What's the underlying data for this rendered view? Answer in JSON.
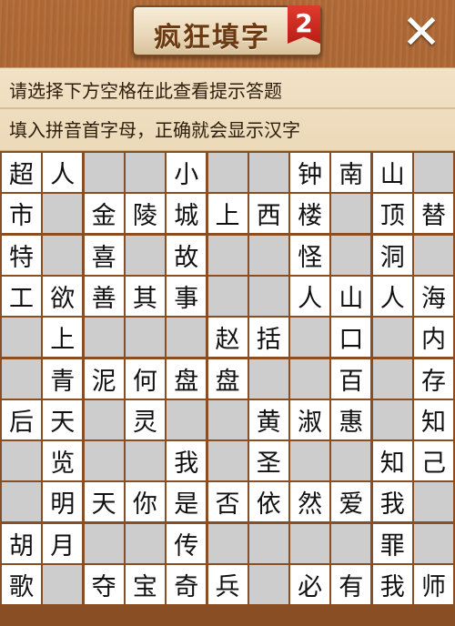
{
  "app": {
    "title": "疯狂填字",
    "level": "2",
    "close_icon": "close-x-icon"
  },
  "hints": {
    "line1": "请选择下方空格在此查看提示答题",
    "line2": "填入拼音首字母，正确就会显示汉字"
  },
  "colors": {
    "wood": "#a5612f",
    "panel": "#f0dfc1",
    "cell_filled": "#ffffff",
    "cell_empty": "#cdcdcd",
    "badge_red": "#d42b22"
  },
  "grid": {
    "rows": [
      [
        "超",
        "人",
        "",
        "",
        "小",
        "",
        "",
        "钟",
        "南",
        "山",
        ""
      ],
      [
        "市",
        "",
        "金",
        "陵",
        "城",
        "上",
        "西",
        "楼",
        "",
        "顶",
        "替"
      ],
      [
        "特",
        "",
        "喜",
        "",
        "故",
        "",
        "",
        "怪",
        "",
        "洞",
        ""
      ],
      [
        "工",
        "欲",
        "善",
        "其",
        "事",
        "",
        "",
        "人",
        "山",
        "人",
        "海"
      ],
      [
        "",
        "上",
        "",
        "",
        "",
        "赵",
        "括",
        "",
        "口",
        "",
        "内"
      ],
      [
        "",
        "青",
        "泥",
        "何",
        "盘",
        "盘",
        "",
        "",
        "百",
        "",
        "存"
      ],
      [
        "后",
        "天",
        "",
        "灵",
        "",
        "",
        "黄",
        "淑",
        "惠",
        "",
        "知"
      ],
      [
        "",
        "览",
        "",
        "",
        "我",
        "",
        "圣",
        "",
        "",
        "知",
        "己"
      ],
      [
        "",
        "明",
        "天",
        "你",
        "是",
        "否",
        "依",
        "然",
        "爱",
        "我",
        ""
      ],
      [
        "胡",
        "月",
        "",
        "",
        "传",
        "",
        "",
        "",
        "",
        "罪",
        ""
      ],
      [
        "歌",
        "",
        "夺",
        "宝",
        "奇",
        "兵",
        "",
        "必",
        "有",
        "我",
        "师"
      ]
    ],
    "blank_mask": [
      [
        0,
        0,
        1,
        1,
        0,
        1,
        1,
        0,
        0,
        0,
        1
      ],
      [
        0,
        1,
        0,
        0,
        0,
        0,
        0,
        0,
        1,
        0,
        0
      ],
      [
        0,
        1,
        0,
        1,
        0,
        1,
        1,
        0,
        1,
        0,
        1
      ],
      [
        0,
        0,
        0,
        0,
        0,
        1,
        1,
        0,
        0,
        0,
        0
      ],
      [
        1,
        0,
        1,
        1,
        1,
        0,
        0,
        1,
        0,
        1,
        0
      ],
      [
        1,
        0,
        0,
        0,
        0,
        0,
        1,
        1,
        0,
        1,
        0
      ],
      [
        0,
        0,
        1,
        0,
        1,
        1,
        0,
        0,
        0,
        1,
        0
      ],
      [
        1,
        0,
        1,
        1,
        0,
        1,
        0,
        1,
        1,
        0,
        0
      ],
      [
        1,
        0,
        0,
        0,
        0,
        0,
        0,
        0,
        0,
        0,
        1
      ],
      [
        0,
        0,
        1,
        1,
        0,
        1,
        1,
        1,
        1,
        0,
        1
      ],
      [
        0,
        1,
        0,
        0,
        0,
        0,
        1,
        0,
        0,
        0,
        0
      ]
    ]
  }
}
